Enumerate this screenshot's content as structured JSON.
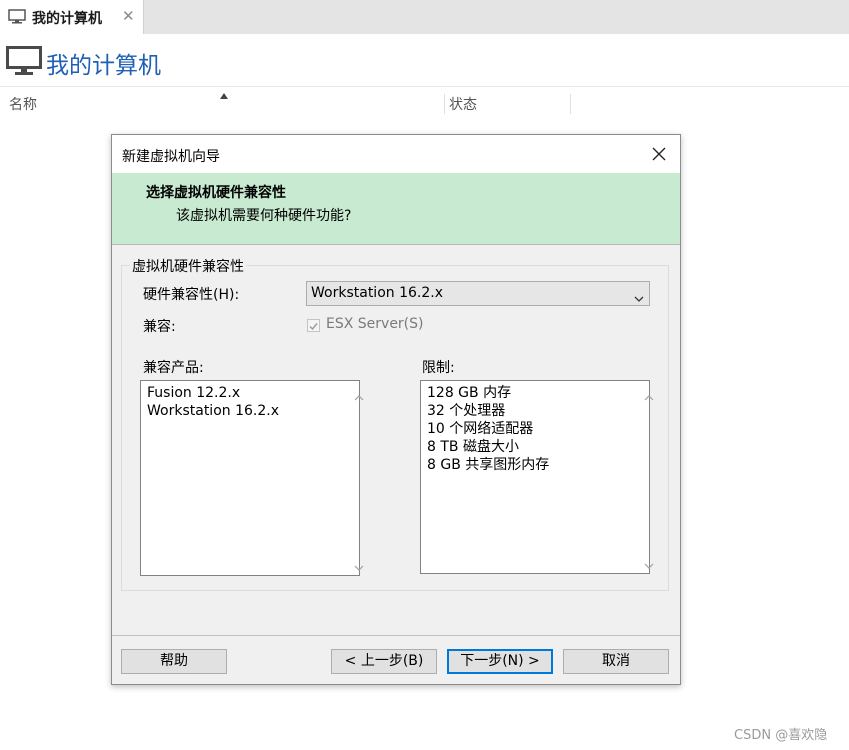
{
  "tab": {
    "title": "我的计算机",
    "close_glyph": "✕",
    "icon": "monitor-icon"
  },
  "page": {
    "title": "我的计算机",
    "icon": "monitor-icon"
  },
  "columns": {
    "name": "名称",
    "status": "状态"
  },
  "dialog": {
    "title": "新建虚拟机向导",
    "close_icon": "close-icon",
    "banner": {
      "heading": "选择虚拟机硬件兼容性",
      "subheading": "该虚拟机需要何种硬件功能?"
    },
    "group_label": "虚拟机硬件兼容性",
    "compat_label": "硬件兼容性(H):",
    "compat_value": "Workstation 16.2.x",
    "compatible_label": "兼容:",
    "esx_label": "ESX Server(S)",
    "esx_checked": true,
    "esx_enabled": false,
    "products_label": "兼容产品:",
    "products": [
      "Fusion 12.2.x",
      "Workstation 16.2.x"
    ],
    "limits_label": "限制:",
    "limits": [
      "128 GB 内存",
      "32 个处理器",
      "10 个网络适配器",
      "8 TB 磁盘大小",
      "8 GB 共享图形内存"
    ],
    "buttons": {
      "help": "帮助",
      "back": "< 上一步(B)",
      "next": "下一步(N) >",
      "cancel": "取消"
    }
  },
  "watermark": "CSDN @喜欢隐",
  "colors": {
    "title_blue": "#1f5fb5",
    "banner_green": "#c7ead0",
    "focus_blue": "#0078d7"
  }
}
